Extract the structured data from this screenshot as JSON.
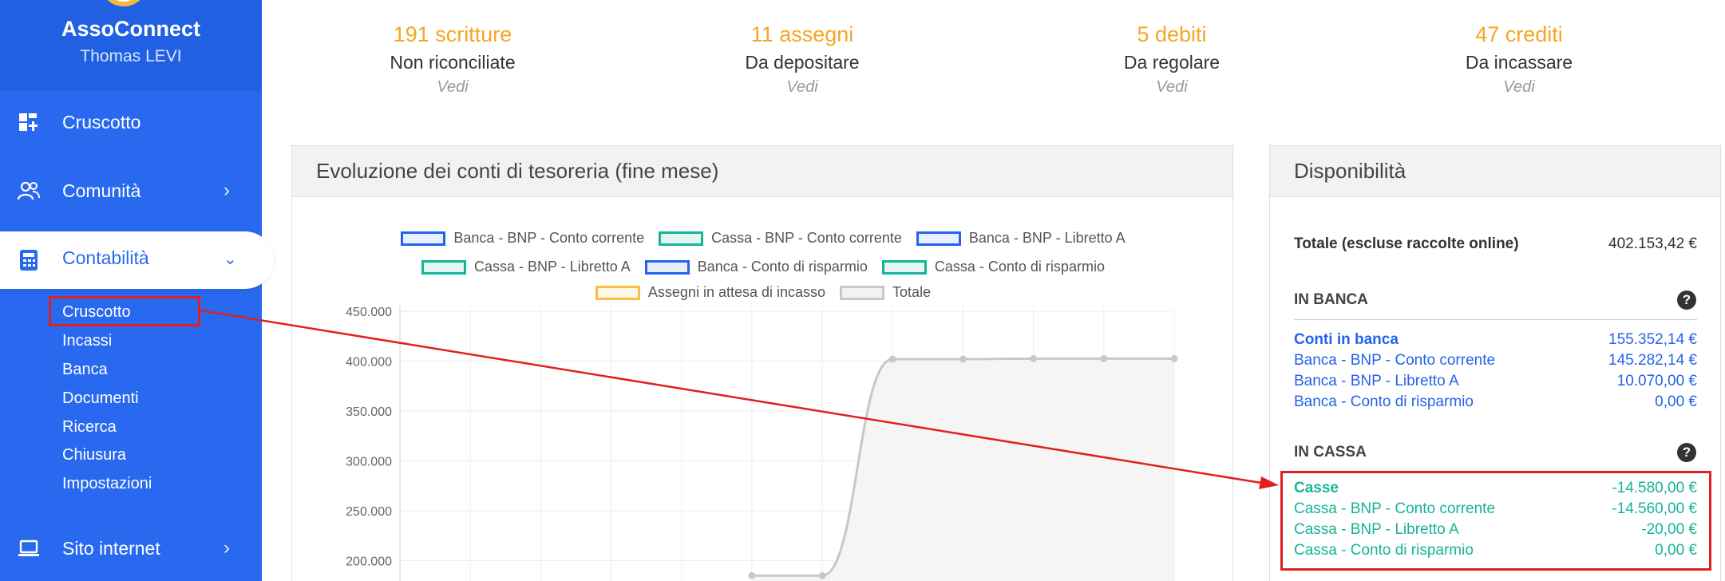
{
  "sidebar": {
    "brand": "AssoConnect",
    "user": "Thomas LEVI",
    "nav": [
      {
        "label": "Cruscotto",
        "icon": "dashboard-icon"
      },
      {
        "label": "Comunità",
        "icon": "community-icon"
      },
      {
        "label": "Contabilità",
        "icon": "calculator-icon"
      },
      {
        "label": "Sito internet",
        "icon": "laptop-icon"
      }
    ],
    "sub_items": [
      "Cruscotto",
      "Incassi",
      "Banca",
      "Documenti",
      "Ricerca",
      "Chiusura",
      "Impostazioni"
    ]
  },
  "stats": [
    {
      "count": "191 scritture",
      "label": "Non riconciliate",
      "link": "Vedi"
    },
    {
      "count": "11 assegni",
      "label": "Da depositare",
      "link": "Vedi"
    },
    {
      "count": "5 debiti",
      "label": "Da regolare",
      "link": "Vedi"
    },
    {
      "count": "47 crediti",
      "label": "Da incassare",
      "link": "Vedi"
    }
  ],
  "chart_panel": {
    "title": "Evoluzione dei conti di tesoreria (fine mese)"
  },
  "chart_data": {
    "type": "line",
    "title": "",
    "xlabel": "",
    "ylabel": "",
    "ylim": [
      200000,
      450000
    ],
    "y_ticks": [
      "450.000",
      "400.000",
      "350.000",
      "300.000",
      "250.000",
      "200.000"
    ],
    "legend_placement": "top",
    "grid": true,
    "series": [
      {
        "name": "Banca - BNP - Conto corrente",
        "color": "#2563eb",
        "values": []
      },
      {
        "name": "Cassa - BNP - Conto corrente",
        "color": "#17b497",
        "values": []
      },
      {
        "name": "Banca - BNP - Libretto A",
        "color": "#2563eb",
        "values": []
      },
      {
        "name": "Cassa - BNP - Libretto A",
        "color": "#17b497",
        "values": []
      },
      {
        "name": "Banca - Conto di risparmio",
        "color": "#2563eb",
        "values": []
      },
      {
        "name": "Cassa - Conto di risparmio",
        "color": "#17b497",
        "values": []
      },
      {
        "name": "Assegni in attesa di incasso",
        "color": "#f5c04a",
        "values": []
      },
      {
        "name": "Totale",
        "color": "#c8c8c8",
        "values": [
          null,
          null,
          null,
          null,
          null,
          185000,
          185000,
          402000,
          402000,
          402500,
          402500,
          402500
        ]
      }
    ]
  },
  "availability": {
    "title": "Disponibilità",
    "total_label": "Totale (escluse raccolte online)",
    "total_value": "402.153,42 €",
    "bank_section": "IN BANCA",
    "bank_rows": [
      {
        "label": "Conti in banca",
        "value": "155.352,14 €"
      },
      {
        "label": "Banca - BNP - Conto corrente",
        "value": "145.282,14 €"
      },
      {
        "label": "Banca - BNP - Libretto A",
        "value": "10.070,00 €"
      },
      {
        "label": "Banca - Conto di risparmio",
        "value": "0,00 €"
      }
    ],
    "cash_section": "IN CASSA",
    "cash_rows": [
      {
        "label": "Casse",
        "value": "-14.580,00 €"
      },
      {
        "label": "Cassa - BNP - Conto corrente",
        "value": "-14.560,00 €"
      },
      {
        "label": "Cassa - BNP - Libretto A",
        "value": "-20,00 €"
      },
      {
        "label": "Cassa - Conto di risparmio",
        "value": "0,00 €"
      }
    ],
    "help_glyph": "?"
  }
}
